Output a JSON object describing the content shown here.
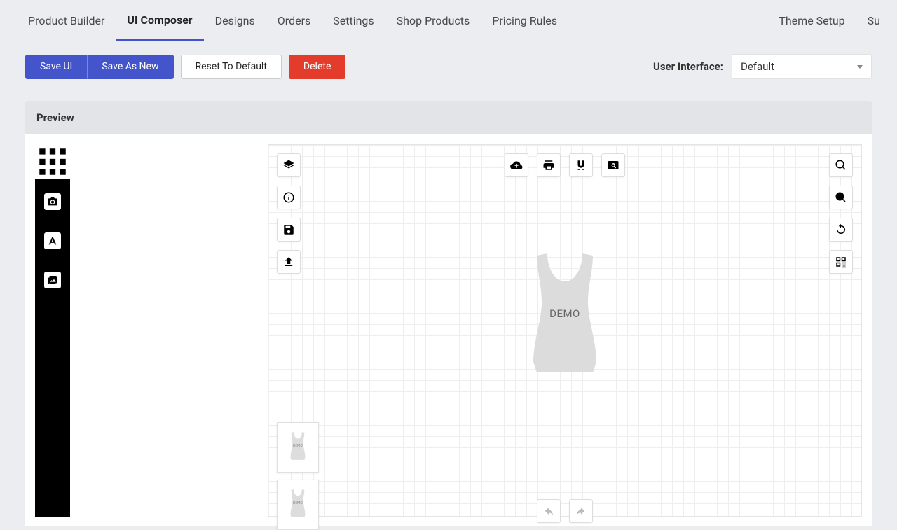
{
  "nav": {
    "left": [
      "Product Builder",
      "UI Composer",
      "Designs",
      "Orders",
      "Settings",
      "Shop Products",
      "Pricing Rules"
    ],
    "activeIndex": 1,
    "right": [
      "Theme Setup",
      "Su"
    ]
  },
  "toolbar": {
    "save_ui": "Save UI",
    "save_as_new": "Save As New",
    "reset": "Reset To Default",
    "delete": "Delete",
    "ui_label": "User Interface:",
    "ui_selected": "Default"
  },
  "preview": {
    "title": "Preview"
  },
  "canvas": {
    "demo_label": "DEMO",
    "thumb_label": "DEMO"
  },
  "icons": {
    "left_rail": [
      "apps-icon",
      "camera-icon",
      "text-icon",
      "image-icon"
    ],
    "left_tools": [
      "layers-icon",
      "info-icon",
      "save-icon",
      "upload-icon"
    ],
    "top_tools": [
      "cloud-upload-icon",
      "print-icon",
      "magnet-icon",
      "pageview-icon"
    ],
    "right_tools": [
      "search-icon",
      "zoom-in-icon",
      "refresh-icon",
      "qr-icon"
    ],
    "bottom_tools": [
      "undo-icon",
      "redo-icon"
    ]
  }
}
